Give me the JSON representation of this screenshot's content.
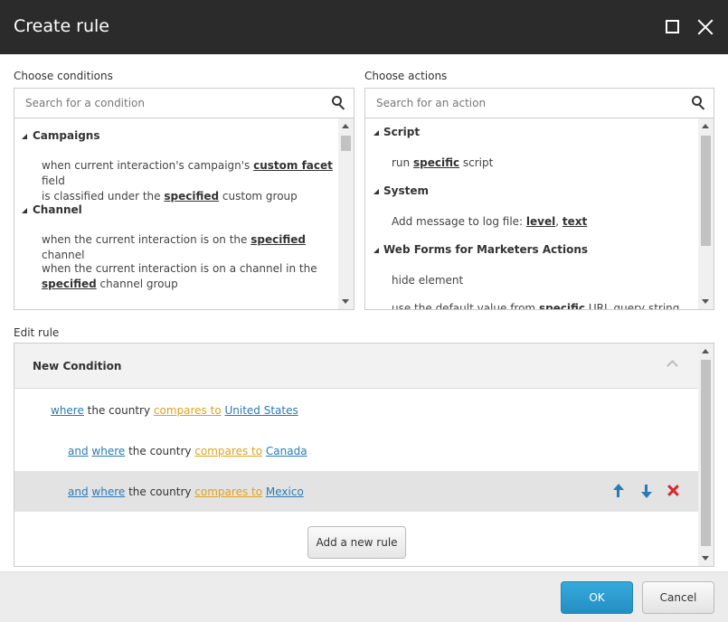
{
  "window": {
    "title": "Create rule"
  },
  "conditions": {
    "label": "Choose conditions",
    "search_placeholder": "Search for a condition",
    "groups": [
      {
        "name": "Campaigns",
        "items": [
          {
            "parts": [
              "when current interaction's campaign's ",
              "custom facet",
              " field",
              "is classified under the ",
              "specified",
              " custom group"
            ]
          }
        ]
      },
      {
        "name": "Channel",
        "items": [
          {
            "parts": [
              "when the current interaction is on the ",
              "specified",
              " channel"
            ]
          },
          {
            "parts": [
              "when the current interaction is on a channel in the",
              "specified",
              " channel group"
            ]
          }
        ]
      }
    ]
  },
  "actions": {
    "label": "Choose actions",
    "search_placeholder": "Search for an action",
    "groups": [
      {
        "name": "Script",
        "items": [
          {
            "parts": [
              "run ",
              "specific",
              " script"
            ]
          }
        ]
      },
      {
        "name": "System",
        "items": [
          {
            "parts": [
              "Add message to log file: ",
              "level",
              ", ",
              "text"
            ]
          }
        ]
      },
      {
        "name": "Web Forms for Marketers Actions",
        "items": [
          {
            "parts": [
              "hide element"
            ]
          },
          {
            "parts": [
              "use the default value from ",
              "specific",
              " URL query string"
            ]
          }
        ]
      }
    ]
  },
  "edit_rule": {
    "label": "Edit rule",
    "condition_title": "New Condition",
    "rows": [
      {
        "and": "",
        "where": "where",
        "text": " the country ",
        "op": "compares to",
        "value": "United States"
      },
      {
        "and": "and",
        "where": "where",
        "text": " the country ",
        "op": "compares to",
        "value": "Canada"
      },
      {
        "and": "and",
        "where": "where",
        "text": " the country ",
        "op": "compares to",
        "value": "Mexico"
      }
    ],
    "add_button": "Add a new rule"
  },
  "footer": {
    "ok": "OK",
    "cancel": "Cancel"
  },
  "colors": {
    "titlebar": "#2b2b2b",
    "link": "#2a7bb5",
    "operator": "#e0a21c",
    "delete": "#d9262a",
    "ok": "#2b9bd0"
  }
}
